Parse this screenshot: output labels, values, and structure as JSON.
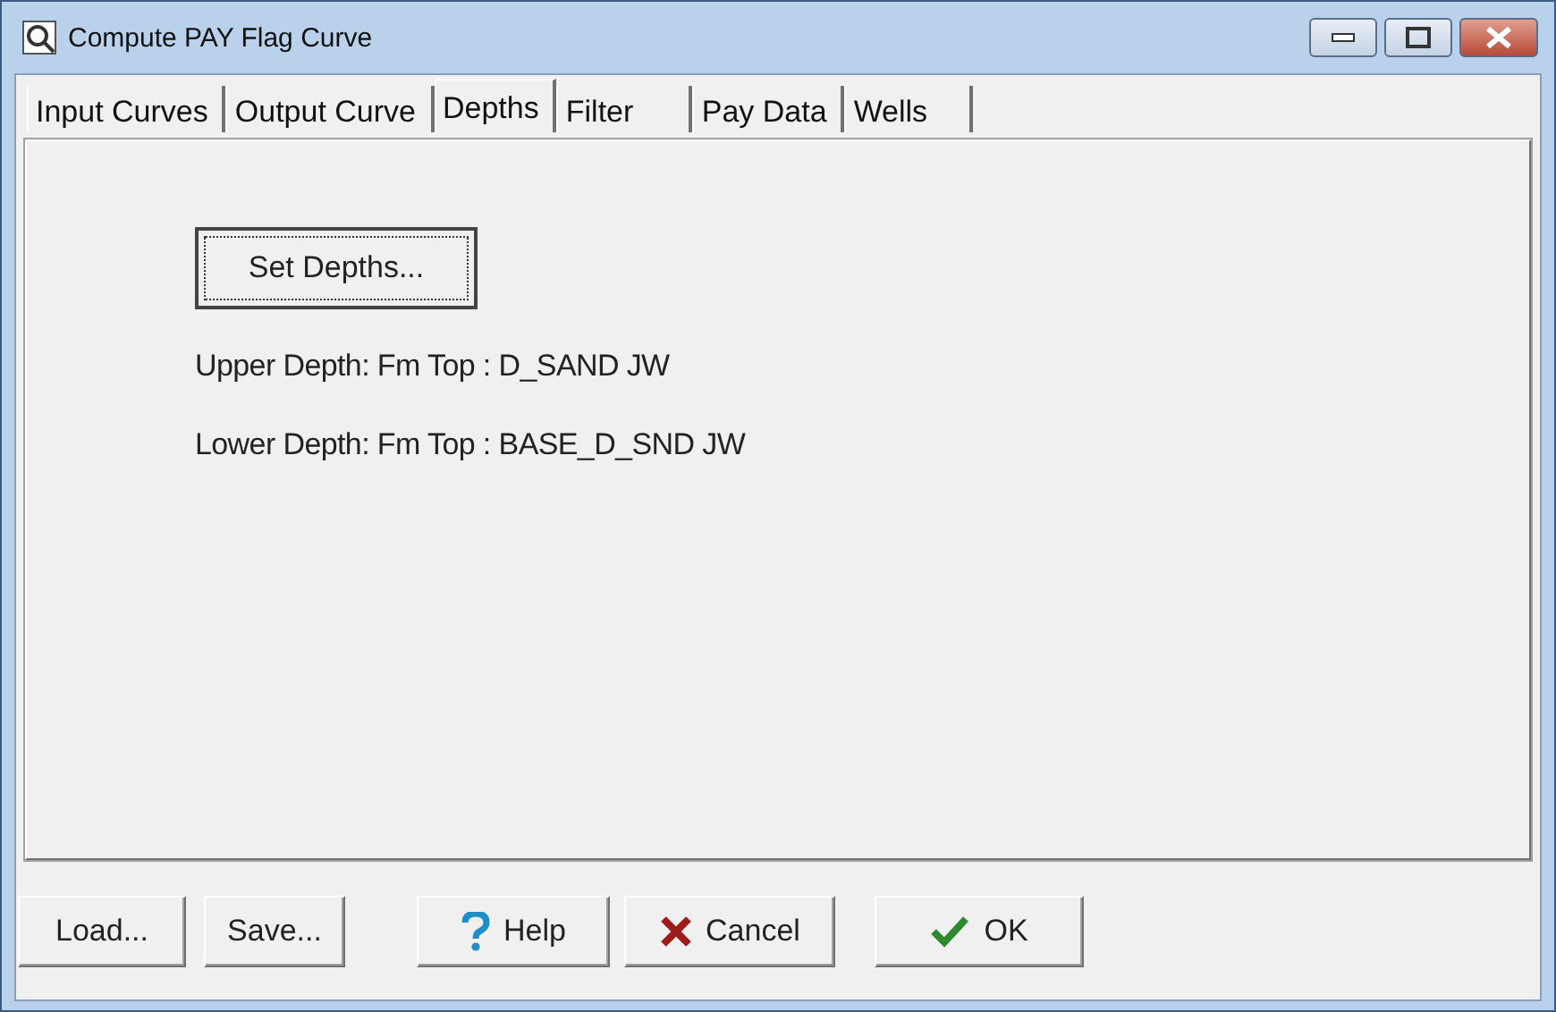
{
  "window": {
    "title": "Compute PAY Flag Curve"
  },
  "tabs": [
    {
      "label": "Input Curves",
      "selected": false
    },
    {
      "label": "Output Curve",
      "selected": false
    },
    {
      "label": "Depths",
      "selected": true
    },
    {
      "label": "Filter",
      "selected": false
    },
    {
      "label": "Pay Data",
      "selected": false
    },
    {
      "label": "Wells",
      "selected": false
    }
  ],
  "depths": {
    "button": "Set Depths...",
    "upper": "Upper Depth: Fm Top : D_SAND JW",
    "lower": "Lower Depth: Fm Top : BASE_D_SND JW"
  },
  "buttons": [
    {
      "label": "Load...",
      "kind": "plain"
    },
    {
      "label": "Save...",
      "kind": "plain"
    },
    {
      "label": "Help",
      "kind": "help"
    },
    {
      "label": "Cancel",
      "kind": "cancel"
    },
    {
      "label": "OK",
      "kind": "ok"
    }
  ]
}
